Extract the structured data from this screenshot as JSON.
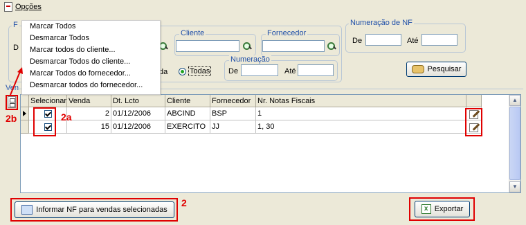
{
  "menu": {
    "label": "Opções"
  },
  "context_menu": {
    "items": [
      "Marcar Todos",
      "Desmarcar Todos",
      "Marcar todos do cliente...",
      "Desmarcar Todos do cliente...",
      "Marcar Todos do fornecedor...",
      "Desmarcar todos do fornecedor..."
    ]
  },
  "filters": {
    "cliente_label": "Cliente",
    "fornecedor_label": "Fornecedor",
    "partial_left_label_1": "F",
    "partial_left_label_2": "D",
    "radio_partial_label": "da",
    "radio_todas_label": "Todas",
    "numeracao_label": "Numeração",
    "numeracao_de_label": "De",
    "numeracao_ate_label": "Até",
    "nf_group_label": "Numeração de NF",
    "nf_de_label": "De",
    "nf_ate_label": "Até",
    "pesquisar_label": "Pesquisar",
    "grid_group_partial_label": "Ven"
  },
  "grid": {
    "columns": [
      "Selecionar",
      "Venda",
      "Dt. Lcto",
      "Cliente",
      "Fornecedor",
      "Nr. Notas Fiscais"
    ],
    "rows": [
      {
        "venda": "2",
        "dt": "01/12/2006",
        "cliente": "ABCIND",
        "fornecedor": "BSP",
        "notas": "1",
        "selected": true
      },
      {
        "venda": "15",
        "dt": "01/12/2006",
        "cliente": "EXERCITO",
        "fornecedor": "JJ",
        "notas": "1, 30",
        "selected": true
      }
    ]
  },
  "buttons": {
    "informar_label": "Informar NF para vendas selecionadas",
    "exportar_label": "Exportar"
  },
  "annotations": {
    "label_2a": "2a",
    "label_2b": "2b",
    "label_2": "2",
    "color": "#e00000"
  }
}
